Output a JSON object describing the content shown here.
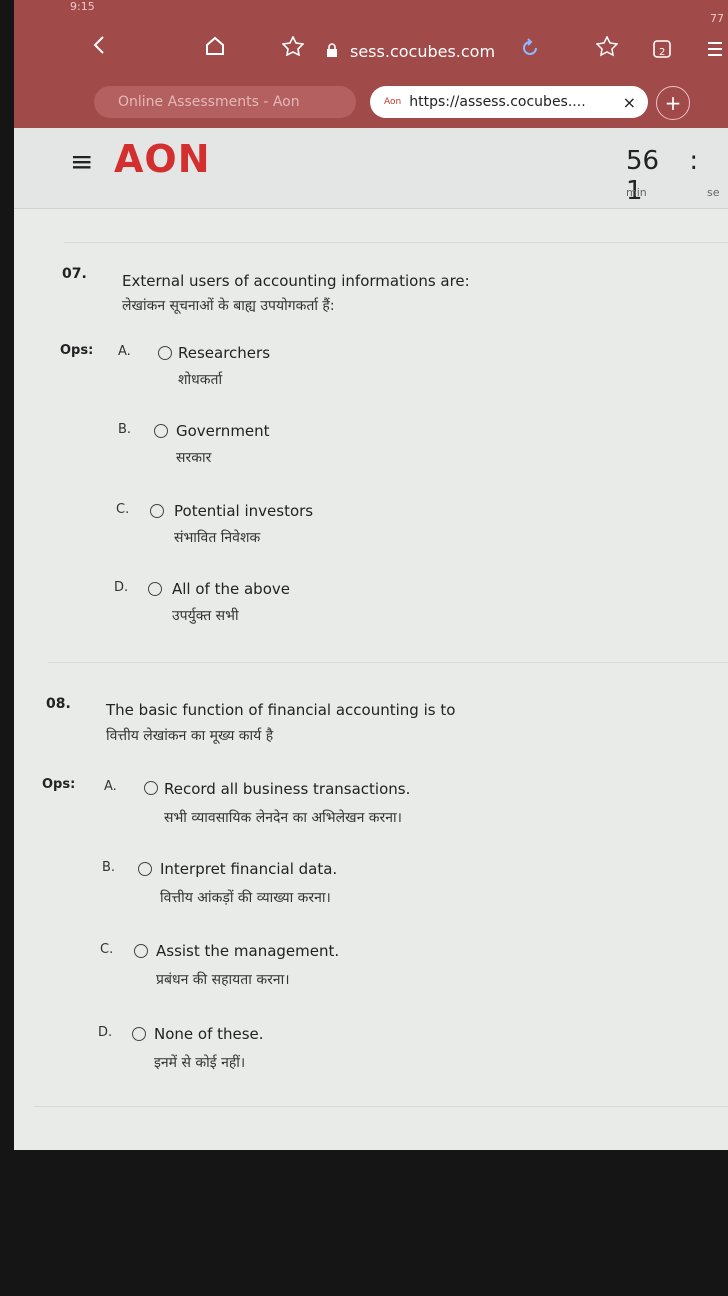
{
  "status": {
    "time": "9:15",
    "right": "77"
  },
  "browser": {
    "url": "sess.cocubes.com",
    "tabs": [
      {
        "label": "Online Assessments - Aon"
      },
      {
        "logo": "Aon",
        "label": "https://assess.cocubes....",
        "close": "×"
      }
    ],
    "new_tab": "+",
    "tab_count": "2",
    "icons": [
      "back-icon",
      "home-icon",
      "star-icon",
      "lock-icon",
      "reload-icon",
      "bookmarks-icon",
      "tabs-icon",
      "menu-icon"
    ]
  },
  "app": {
    "menu_icon": "≡",
    "brand": "AON"
  },
  "timer": {
    "minutes": "56",
    "sep": ":",
    "seconds": "1",
    "min_label": "min",
    "sec_label": "se"
  },
  "questions": [
    {
      "number": "07.",
      "text_en": "External users of accounting informations are:",
      "text_hi": "लेखांकन सूचनाओं के बाह्य उपयोगकर्ता हैं:",
      "ops_label": "Ops:",
      "options": [
        {
          "letter": "A.",
          "en": "Researchers",
          "hi": "शोधकर्ता"
        },
        {
          "letter": "B.",
          "en": "Government",
          "hi": "सरकार"
        },
        {
          "letter": "C.",
          "en": "Potential investors",
          "hi": "संभावित निवेशक"
        },
        {
          "letter": "D.",
          "en": "All of the above",
          "hi": "उपर्युक्त सभी"
        }
      ]
    },
    {
      "number": "08.",
      "text_en": "The basic function of financial accounting is to",
      "text_hi": "वित्तीय लेखांकन का मूख्य कार्य है",
      "ops_label": "Ops:",
      "options": [
        {
          "letter": "A.",
          "en": "Record all business transactions.",
          "hi": "सभी व्यावसायिक लेनदेन का अभिलेखन करना।"
        },
        {
          "letter": "B.",
          "en": "Interpret financial data.",
          "hi": "वित्तीय आंकड़ों की व्याख्या करना।"
        },
        {
          "letter": "C.",
          "en": "Assist the management.",
          "hi": "प्रबंधन की सहायता करना।"
        },
        {
          "letter": "D.",
          "en": "None of these.",
          "hi": "इनमें से कोई नहीं।"
        }
      ]
    }
  ],
  "colors": {
    "chrome": "#a04a4a",
    "brand": "#d32f2f",
    "page": "#e9ebe9"
  }
}
